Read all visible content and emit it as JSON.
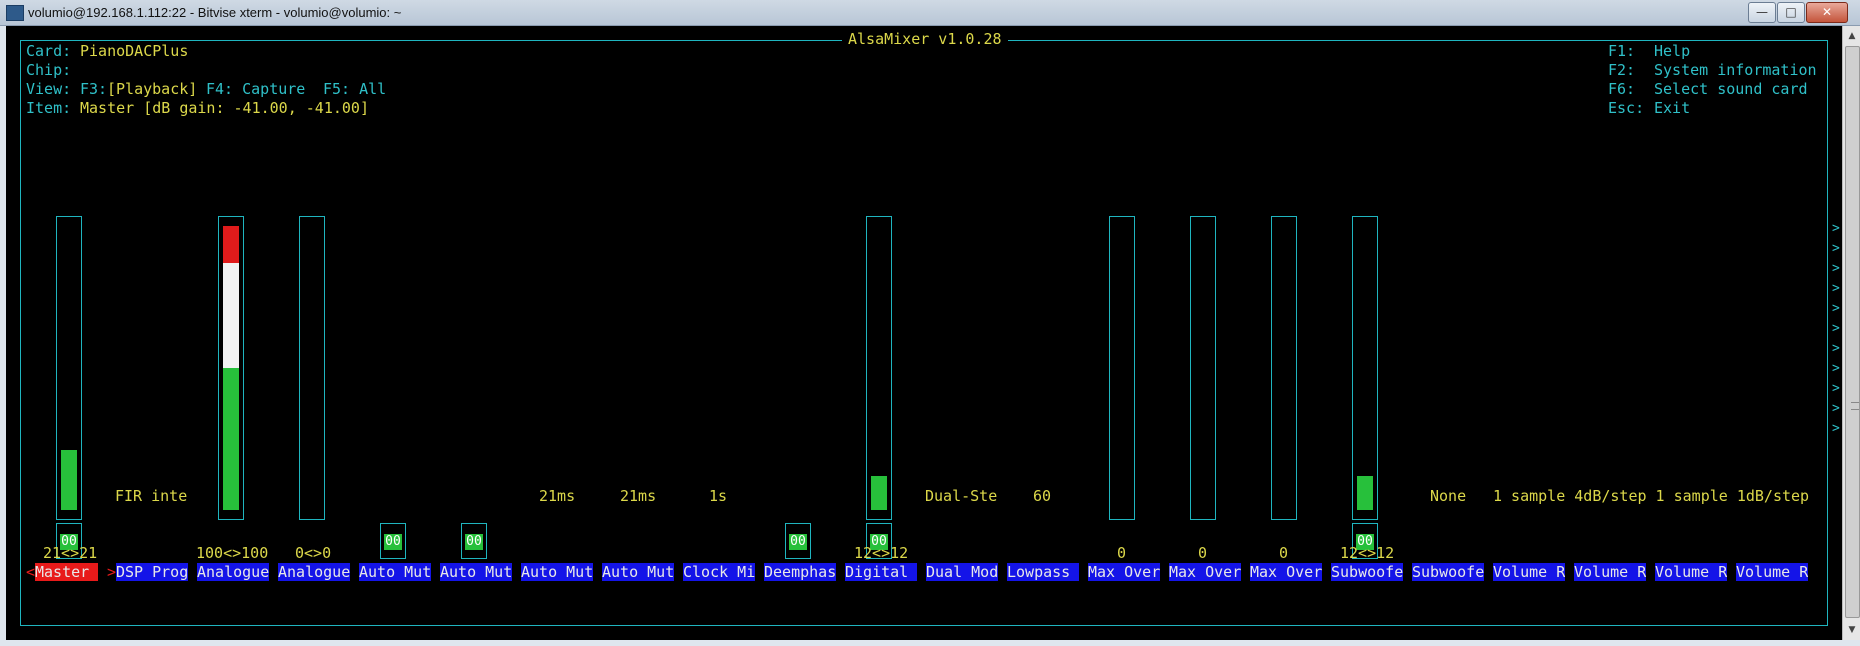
{
  "window": {
    "title": "volumio@192.168.1.112:22 - Bitvise xterm - volumio@volumio: ~",
    "minimize_glyph": "—",
    "maximize_glyph": "□",
    "close_glyph": "✕"
  },
  "mixer": {
    "title": "AlsaMixer v1.0.28",
    "card_label": "Card:",
    "card_value": "PianoDACPlus",
    "chip_label": "Chip:",
    "view_label": "View:",
    "view_f3": "F3:",
    "view_playback": "[Playback]",
    "view_f4": "F4: Capture",
    "view_f5": "F5: All",
    "item_label": "Item:",
    "item_value": "Master [dB gain: -41.00, -41.00]",
    "help": [
      {
        "key": "F1:",
        "text": "Help"
      },
      {
        "key": "F2:",
        "text": "System information"
      },
      {
        "key": "F6:",
        "text": "Select sound card"
      },
      {
        "key": "Esc:",
        "text": "Exit"
      }
    ],
    "enum_values": {
      "fir": "FIR inte",
      "auto1": "21ms",
      "auto2": "21ms",
      "clock": "1s",
      "dual": "Dual-Ste",
      "lowpass": "60",
      "sub_none": "None",
      "vol_r": "1 sample 4dB/step 1 sample 1dB/step"
    },
    "switch_label": "00",
    "levels": {
      "master": "21<>21",
      "analogue1": "100<>100",
      "analogue2": "0<>0",
      "digital": "12<>12",
      "maxover1": "0",
      "maxover2": "0",
      "maxover3": "0",
      "subwoofer": "12<>12"
    },
    "fader_levels": {
      "master": 0.21,
      "analogue1": 1.0,
      "analogue2": 0.0,
      "digital": 0.12,
      "maxover1": 0.0,
      "maxover2": 0.0,
      "maxover3": 0.0,
      "subwoofer": 0.12
    },
    "controls": [
      "Master",
      "DSP Prog",
      "Analogue",
      "Analogue",
      "Auto Mut",
      "Auto Mut",
      "Auto Mut",
      "Auto Mut",
      "Clock Mi",
      "Deemphas",
      "Digital",
      "Dual Mod",
      "Lowpass",
      "Max Over",
      "Max Over",
      "Max Over",
      "Subwoofe",
      "Subwoofe",
      "Volume R",
      "Volume R",
      "Volume R",
      "Volume R"
    ],
    "selected_prefix": "<",
    "selected_suffix": ">",
    "more_arrow": ">"
  },
  "colors": {
    "frame": "#1fb5bf",
    "label_bg": "#1414e8",
    "selected_bg": "#e81a1a",
    "fill_green": "#27c03b",
    "fill_white": "#f2f2f2",
    "fill_red": "#e01b1b"
  }
}
